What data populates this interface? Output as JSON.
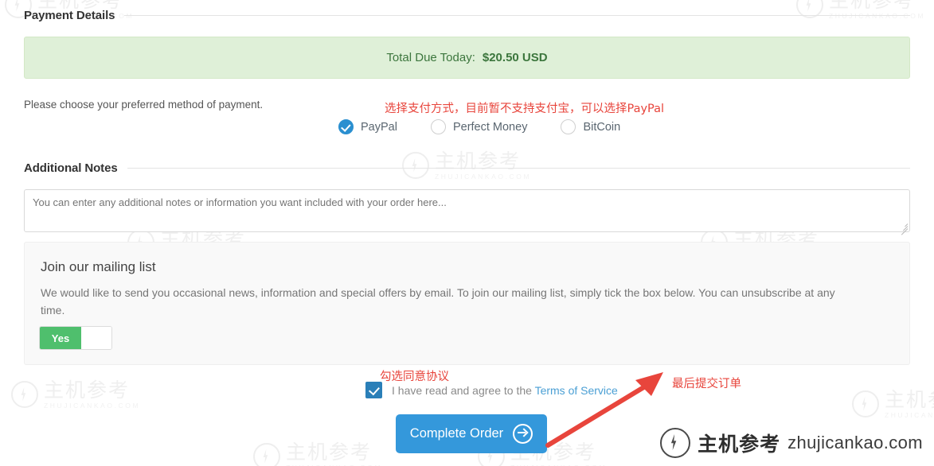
{
  "sections": {
    "payment_details_title": "Payment Details",
    "additional_notes_title": "Additional Notes"
  },
  "total_due": {
    "label": "Total Due Today:",
    "amount": "$20.50 USD",
    "banner_bg": "#dff0d8",
    "text_color": "#3c763d"
  },
  "payment": {
    "instruction": "Please choose your preferred method of payment.",
    "methods": [
      {
        "label": "PayPal",
        "selected": true
      },
      {
        "label": "Perfect Money",
        "selected": false
      },
      {
        "label": "BitCoin",
        "selected": false
      }
    ],
    "selected_color": "#2a8fd0"
  },
  "notes": {
    "placeholder": "You can enter any additional notes or information you want included with your order here...",
    "value": ""
  },
  "mailing_list": {
    "title": "Join our mailing list",
    "body": "We would like to send you occasional news, information and special offers by email. To join our mailing list, simply tick the box below. You can unsubscribe at any time.",
    "toggle_on_label": "Yes",
    "toggle_state": "Yes",
    "toggle_color": "#4fbf6d"
  },
  "terms": {
    "text_before": "I have read and agree to the",
    "link_label": "Terms of Service",
    "checked": true,
    "checkbox_color": "#2a7fb8",
    "link_color": "#4a9fd4"
  },
  "submit": {
    "label": "Complete Order",
    "button_color": "#3498db",
    "icon": "circle-arrow-right-icon"
  },
  "annotations": {
    "color": "#e8453c",
    "payment_note": "选择支付方式，目前暂不支持支付宝，可以选择PayPal",
    "agree_note": "勾选同意协议",
    "submit_note": "最后提交订单"
  },
  "watermark": {
    "cn": "主机参考",
    "en": "ZHUJICANKAO.COM",
    "brand_cn": "主机参考",
    "brand_domain": "zhujicankao.com"
  }
}
